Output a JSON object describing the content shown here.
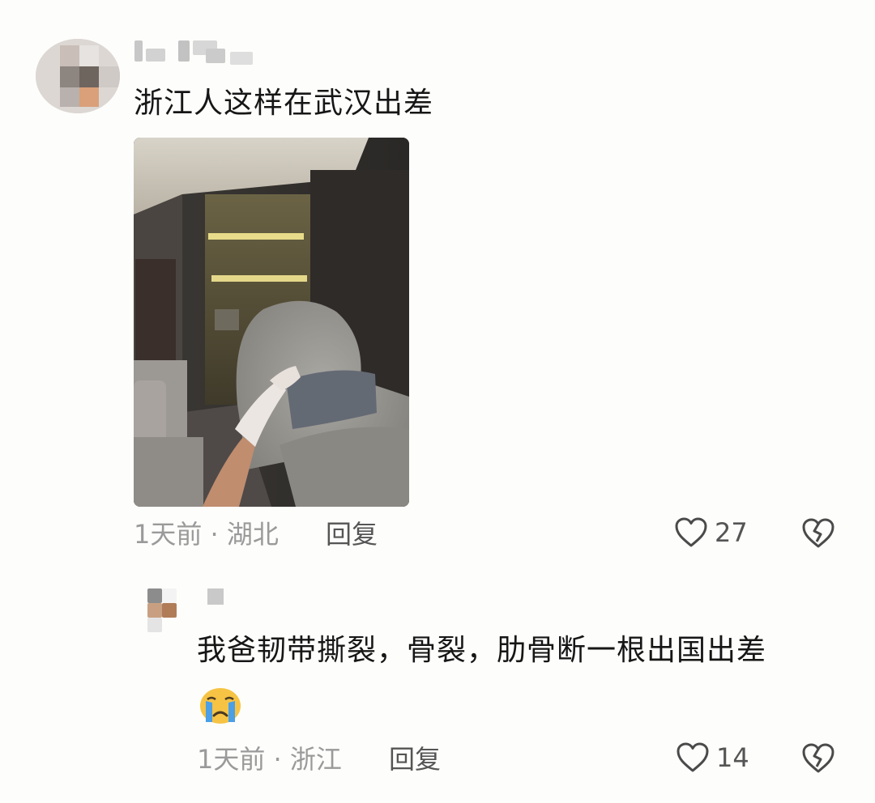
{
  "comment": {
    "text": "浙江人这样在武汉出差",
    "meta": "1天前 · 湖北",
    "reply_label": "回复",
    "like_count": "27"
  },
  "reply": {
    "text": "我爸韧带撕裂，骨裂，肋骨断一根出国出差",
    "emoji": "crying-face",
    "meta": "1天前 · 浙江",
    "reply_label": "回复",
    "like_count": "14"
  },
  "icons": {
    "like": "heart-outline-icon",
    "dislike": "broken-heart-icon"
  },
  "colors": {
    "background": "#fdfdfb",
    "text": "#161616",
    "meta": "#9a9a9a"
  }
}
